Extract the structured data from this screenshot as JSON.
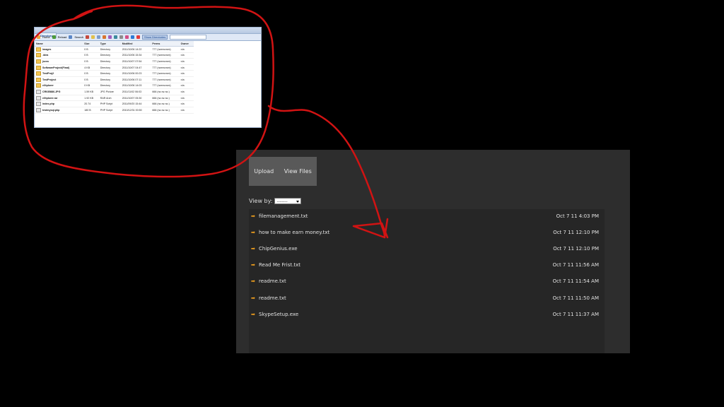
{
  "file_manager": {
    "tab_label": "Directory",
    "toolbar": {
      "home": "Home",
      "reload": "Reload",
      "search": "Search",
      "show_dirs": "Show Directories"
    },
    "columns": [
      "Name",
      "Size",
      "Type",
      "Modified",
      "Perms",
      "Owner"
    ],
    "rows": [
      {
        "icon": "folder-icon",
        "name": "images",
        "size": "0 B",
        "type": "Directory",
        "modified": "2011/10/06 14:22",
        "perms": "777 (rwxrwxrwx)",
        "owner": "n/a"
      },
      {
        "icon": "folder-icon",
        "name": ".idea",
        "size": "0 B",
        "type": "Directory",
        "modified": "2011/10/06 15:34",
        "perms": "777 (rwxrwxrwx)",
        "owner": "n/a"
      },
      {
        "icon": "folder-icon",
        "name": "jscss",
        "size": "0 B",
        "type": "Directory",
        "modified": "2011/10/07 07:54",
        "perms": "777 (rwxrwxrwx)",
        "owner": "n/a"
      },
      {
        "icon": "folder-icon",
        "name": "SoftwareProject(Final)",
        "size": "4 KB",
        "type": "Directory",
        "modified": "2011/10/07 04:47",
        "perms": "777 (rwxrwxrwx)",
        "owner": "n/a"
      },
      {
        "icon": "folder-icon",
        "name": "TestProj2",
        "size": "0 B",
        "type": "Directory",
        "modified": "2011/10/06 00:23",
        "perms": "777 (rwxrwxrwx)",
        "owner": "n/a"
      },
      {
        "icon": "folder-icon",
        "name": "TestProject",
        "size": "0 B",
        "type": "Directory",
        "modified": "2011/10/06 07:11",
        "perms": "777 (rwxrwxrwx)",
        "owner": "n/a"
      },
      {
        "icon": "folder-icon",
        "name": "eXtplorer",
        "size": "0 KB",
        "type": "Directory",
        "modified": "2011/10/06 14:03",
        "perms": "777 (rwxrwxrwx)",
        "owner": "n/a"
      },
      {
        "icon": "file-icon",
        "name": "CR035886.JPG",
        "size": "1.59 KB",
        "type": "JPG Picture",
        "modified": "2011/11/02 06:03",
        "perms": "666 (rw-rw-rw-)",
        "owner": "n/a"
      },
      {
        "icon": "file-icon",
        "name": "eXtplorer.rar",
        "size": "1.92 KB",
        "type": "RAR Arch",
        "modified": "2011/10/07 05:30",
        "perms": "666 (rw-rw-rw-)",
        "owner": "n/a"
      },
      {
        "icon": "file-icon",
        "name": "index.php",
        "size": "20.74",
        "type": "PHP Script",
        "modified": "2011/09/20 15:44",
        "perms": "666 (rw-rw-rw-)",
        "owner": "n/a"
      },
      {
        "icon": "file-icon",
        "name": "testmysql.php",
        "size": "180 B",
        "type": "PHP Script",
        "modified": "2010/12/31 00:50",
        "perms": "666 (rw-rw-rw-)",
        "owner": "n/a"
      }
    ]
  },
  "panel": {
    "tabs": {
      "upload": "Upload",
      "view_files": "View Files"
    },
    "view_by_label": "View by:",
    "view_by_value": "-------",
    "files": [
      {
        "name": "filemanagement.txt",
        "date": "Oct 7 11 4:03 PM"
      },
      {
        "name": "how to make earn money.txt",
        "date": "Oct 7 11 12:10 PM"
      },
      {
        "name": "ChipGenius.exe",
        "date": "Oct 7 11 12:10 PM"
      },
      {
        "name": "Read Me Frist.txt",
        "date": "Oct 7 11 11:56 AM"
      },
      {
        "name": "readme.txt",
        "date": "Oct 7 11 11:54 AM"
      },
      {
        "name": "readme.txt",
        "date": "Oct 7 11 11:50 AM"
      },
      {
        "name": "SkypeSetup.exe",
        "date": "Oct 7 11 11:37 AM"
      }
    ]
  },
  "annotation": {
    "color": "#d11313",
    "shapes": [
      "circle-around-file-manager",
      "arrow-to-file-list"
    ]
  },
  "colors": {
    "arrow_icon": "#f3a11d",
    "panel_bg": "#2d2d2d",
    "list_bg": "#262626",
    "tabs_bg": "#595959"
  }
}
